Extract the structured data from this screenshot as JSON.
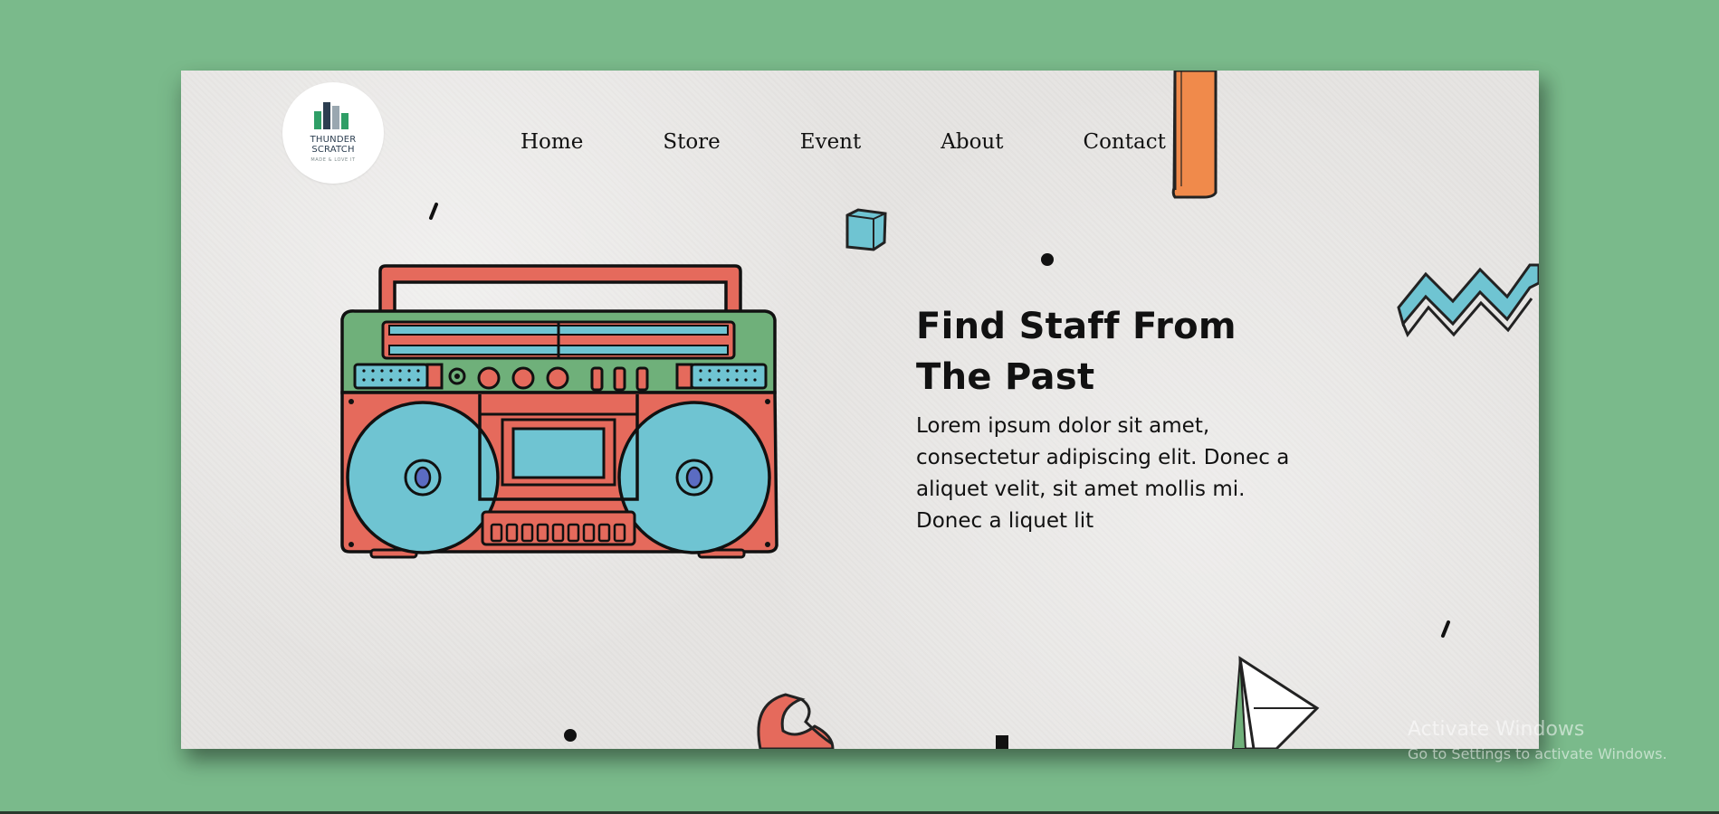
{
  "brand": {
    "logo_name_line1": "THUNDER",
    "logo_name_line2": "SCRATCH",
    "logo_tagline": "MADE & LOVE IT"
  },
  "nav": {
    "items": [
      {
        "label": "Home"
      },
      {
        "label": "Store"
      },
      {
        "label": "Event"
      },
      {
        "label": "About"
      },
      {
        "label": "Contact"
      }
    ]
  },
  "hero": {
    "title": "Find Staff From The Past",
    "text": "Lorem ipsum dolor sit amet, consectetur adipiscing elit. Donec a aliquet velit, sit amet mollis mi. Donec a liquet lit"
  },
  "watermark": {
    "line1": "Activate Windows",
    "line2": "Go to Settings to activate Windows."
  },
  "colors": {
    "page_bg": "#7aba8b",
    "card_bg": "#e6e4e2",
    "boombox_red": "#e56a5c",
    "boombox_green": "#6fb07a",
    "boombox_blue": "#6fc4d2",
    "deco_orange": "#f08a4b"
  },
  "icons": {
    "logo": "bar-chart-logo",
    "illustration": "boombox-illustration"
  }
}
